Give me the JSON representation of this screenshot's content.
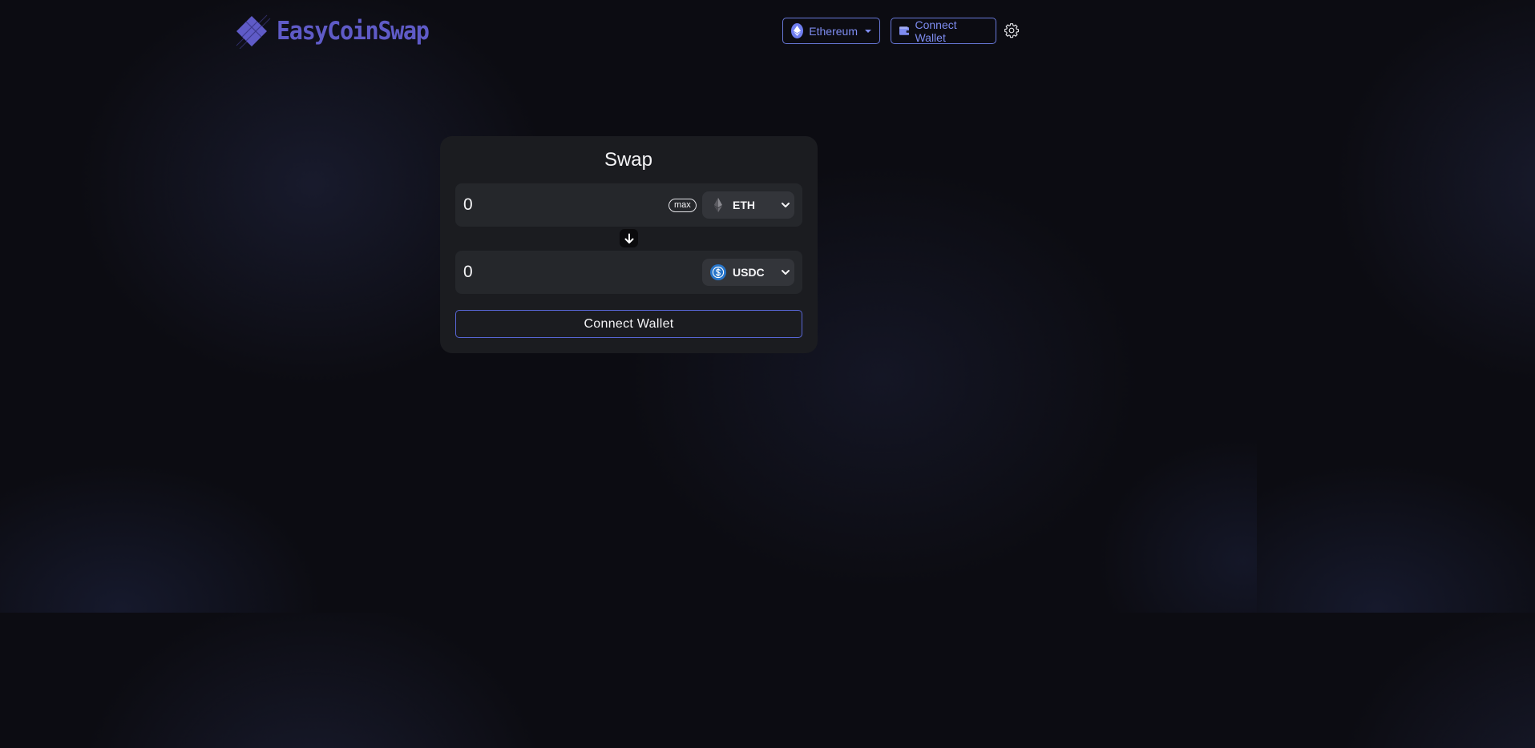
{
  "brand": {
    "name": "EasyCoinSwap",
    "logo_icon": "diamond-logo-icon",
    "color": "#5f5bc7"
  },
  "header": {
    "network_button": {
      "label": "Ethereum",
      "icon": "ethereum-icon"
    },
    "wallet_button": {
      "label": "Connect Wallet",
      "icon": "wallet-icon"
    },
    "settings_icon": "gear-icon",
    "accent": "#6878d8"
  },
  "swap": {
    "title": "Swap",
    "from": {
      "amount": "0",
      "max_label": "max",
      "token": "ETH",
      "token_icon": "ethereum-icon"
    },
    "switch_icon": "arrow-down-icon",
    "to": {
      "amount": "0",
      "token": "USDC",
      "token_icon": "usdc-icon",
      "token_color": "#2775ca"
    },
    "action_label": "Connect Wallet"
  }
}
